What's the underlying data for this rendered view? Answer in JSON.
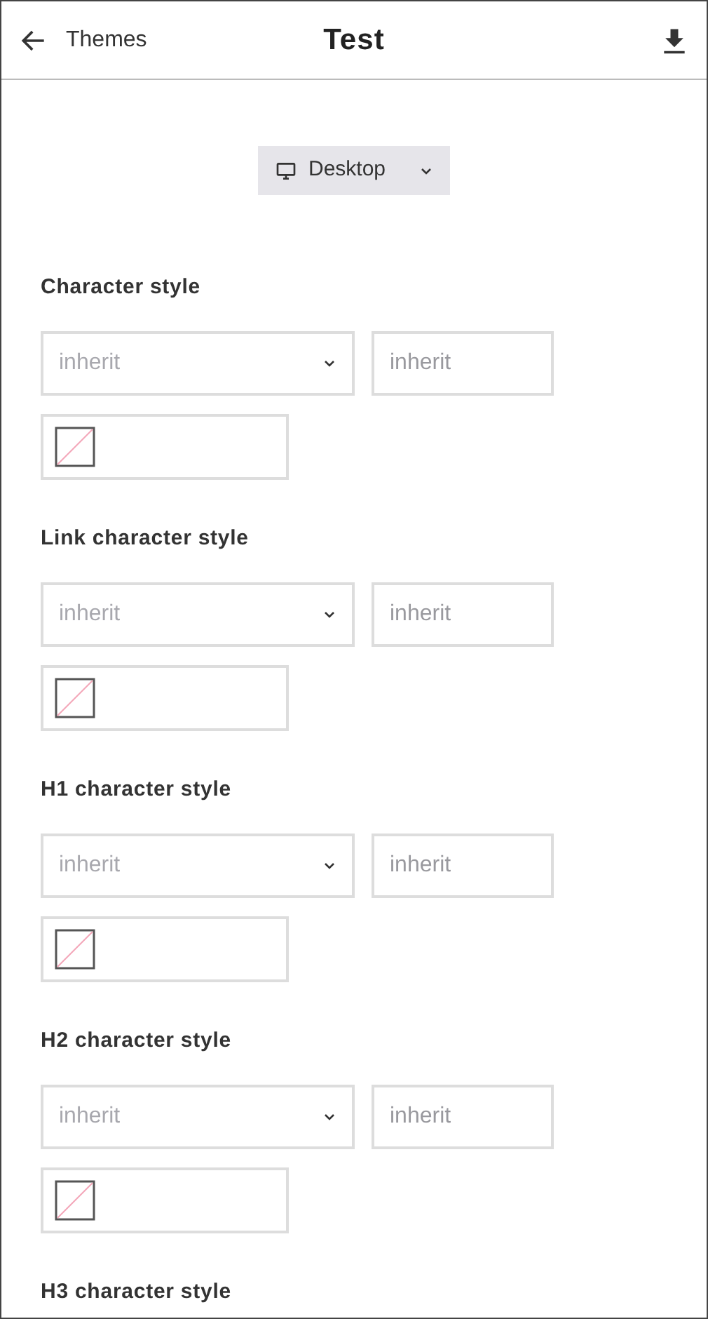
{
  "header": {
    "back_label": "Themes",
    "title": "Test"
  },
  "device_select": {
    "value": "Desktop"
  },
  "sections": [
    {
      "heading": "Character style",
      "font_select": {
        "placeholder": "inherit"
      },
      "size_field": {
        "placeholder": "inherit"
      },
      "color_swatch": {
        "kind": "none"
      }
    },
    {
      "heading": "Link character style",
      "font_select": {
        "placeholder": "inherit"
      },
      "size_field": {
        "placeholder": "inherit"
      },
      "color_swatch": {
        "kind": "none"
      }
    },
    {
      "heading": "H1 character style",
      "font_select": {
        "placeholder": "inherit"
      },
      "size_field": {
        "placeholder": "inherit"
      },
      "color_swatch": {
        "kind": "none"
      }
    },
    {
      "heading": "H2 character style",
      "font_select": {
        "placeholder": "inherit"
      },
      "size_field": {
        "placeholder": "inherit"
      },
      "color_swatch": {
        "kind": "none"
      }
    },
    {
      "heading": "H3 character style"
    }
  ]
}
